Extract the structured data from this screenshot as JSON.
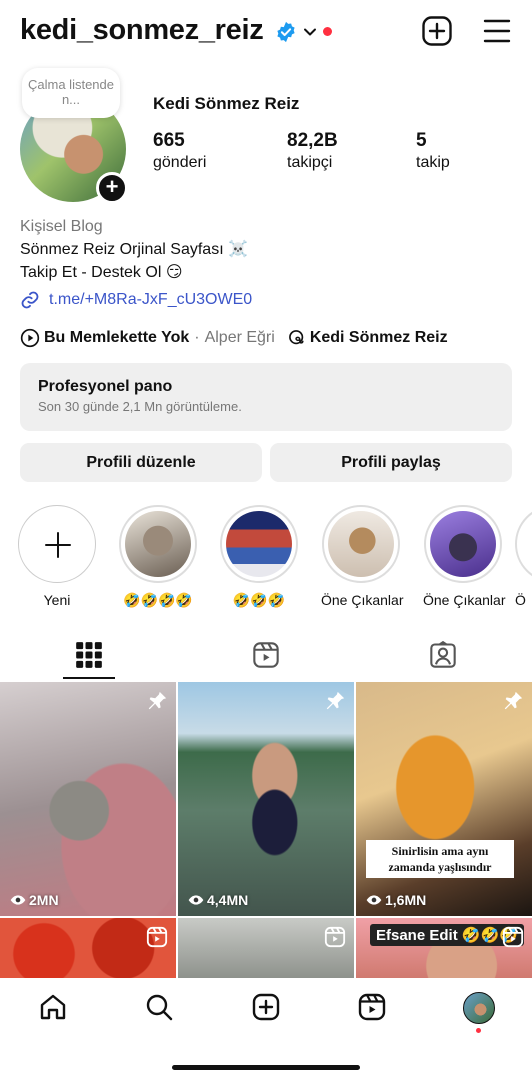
{
  "header": {
    "username": "kedi_sonmez_reiz",
    "verified_icon": "verified-badge-icon",
    "dropdown_icon": "chevron-down-icon",
    "create_icon": "plus-square-icon",
    "menu_icon": "hamburger-menu-icon",
    "notification_dot_color": "#ff3040"
  },
  "profile": {
    "note": "Çalma listende n...",
    "display_name": "Kedi Sönmez Reiz",
    "stats": [
      {
        "num": "665",
        "label": "gönderi"
      },
      {
        "num": "82,2B",
        "label": "takipçi"
      },
      {
        "num": "5",
        "label": "takip"
      }
    ],
    "category": "Kişisel Blog",
    "bio_line1": "Sönmez Reiz Orjinal Sayfası ☠️",
    "bio_line2": "Takip Et - Destek Ol 😏",
    "link": "t.me/+M8Ra-JxF_cU3OWE0",
    "link_color": "#3b55c9",
    "song": "Bu Memlekette Yok",
    "artist_sep": "·",
    "artist": "Alper Eğri",
    "threads_name": "Kedi Sönmez Reiz"
  },
  "pro_panel": {
    "title": "Profesyonel pano",
    "subtitle": "Son 30 günde 2,1 Mn görüntüleme."
  },
  "buttons": {
    "edit": "Profili düzenle",
    "share": "Profili paylaş"
  },
  "highlights": [
    {
      "label": "Yeni"
    },
    {
      "label": "🤣🤣🤣🤣"
    },
    {
      "label": "🤣🤣🤣"
    },
    {
      "label": "Öne Çıkanlar"
    },
    {
      "label": "Öne Çıkanlar"
    },
    {
      "label": "Ö"
    }
  ],
  "tabs": [
    "grid-tab",
    "reels-tab",
    "tagged-tab"
  ],
  "grid": {
    "posts": [
      {
        "views": "2MN",
        "pinned": true
      },
      {
        "views": "4,4MN",
        "pinned": true
      },
      {
        "views": "1,6MN",
        "pinned": true,
        "caption": "Sinirlisin ama aynı zamanda yaşlısındır"
      },
      {
        "reel": true
      },
      {
        "reel": true
      },
      {
        "reel": true,
        "overlay": "Efsane Edit 🤣🤣🤣"
      }
    ]
  },
  "bottom_nav": [
    "home-icon",
    "search-icon",
    "create-icon",
    "reels-icon",
    "profile-avatar"
  ]
}
